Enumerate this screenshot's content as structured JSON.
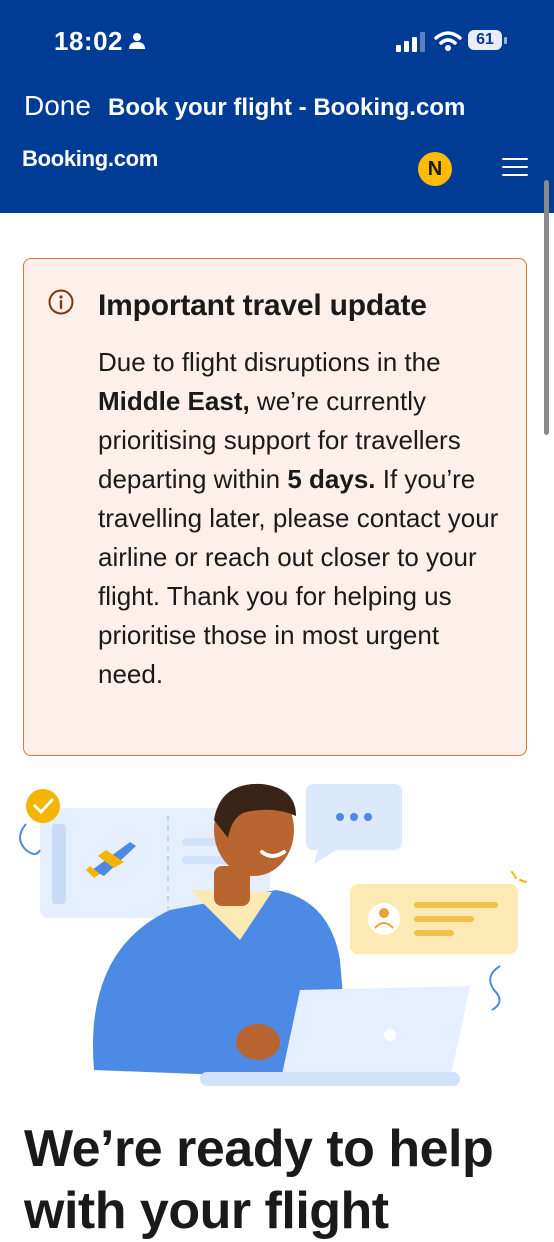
{
  "status_bar": {
    "time": "18:02",
    "battery": "61"
  },
  "browser": {
    "done_label": "Done",
    "page_title": "Book your flight - Booking.com"
  },
  "header": {
    "logo": "Booking.com",
    "avatar_initial": "N"
  },
  "alert": {
    "title": "Important travel update",
    "body": {
      "p1": "Due to flight disruptions in the ",
      "b1": "Middle East,",
      "p2": " we’re currently prioritising support for travellers departing within ",
      "b2": "5 days.",
      "p3": " If you’re travelling later, please contact your airline or reach out closer to your flight. Thank you for helping us prioritise those in most urgent need."
    }
  },
  "hero": {
    "heading": "We’re ready to help with your flight"
  },
  "colors": {
    "brand_blue": "#003b95",
    "alert_bg": "#fdf0ea",
    "alert_border": "#d9772e",
    "accent_yellow": "#febb02"
  },
  "icons": [
    "person-icon",
    "signal-icon",
    "wifi-icon",
    "battery-icon",
    "info-icon",
    "menu-icon",
    "checkmark-icon",
    "airplane-icon",
    "chat-bubble-icon",
    "profile-card-icon",
    "laptop-icon"
  ]
}
